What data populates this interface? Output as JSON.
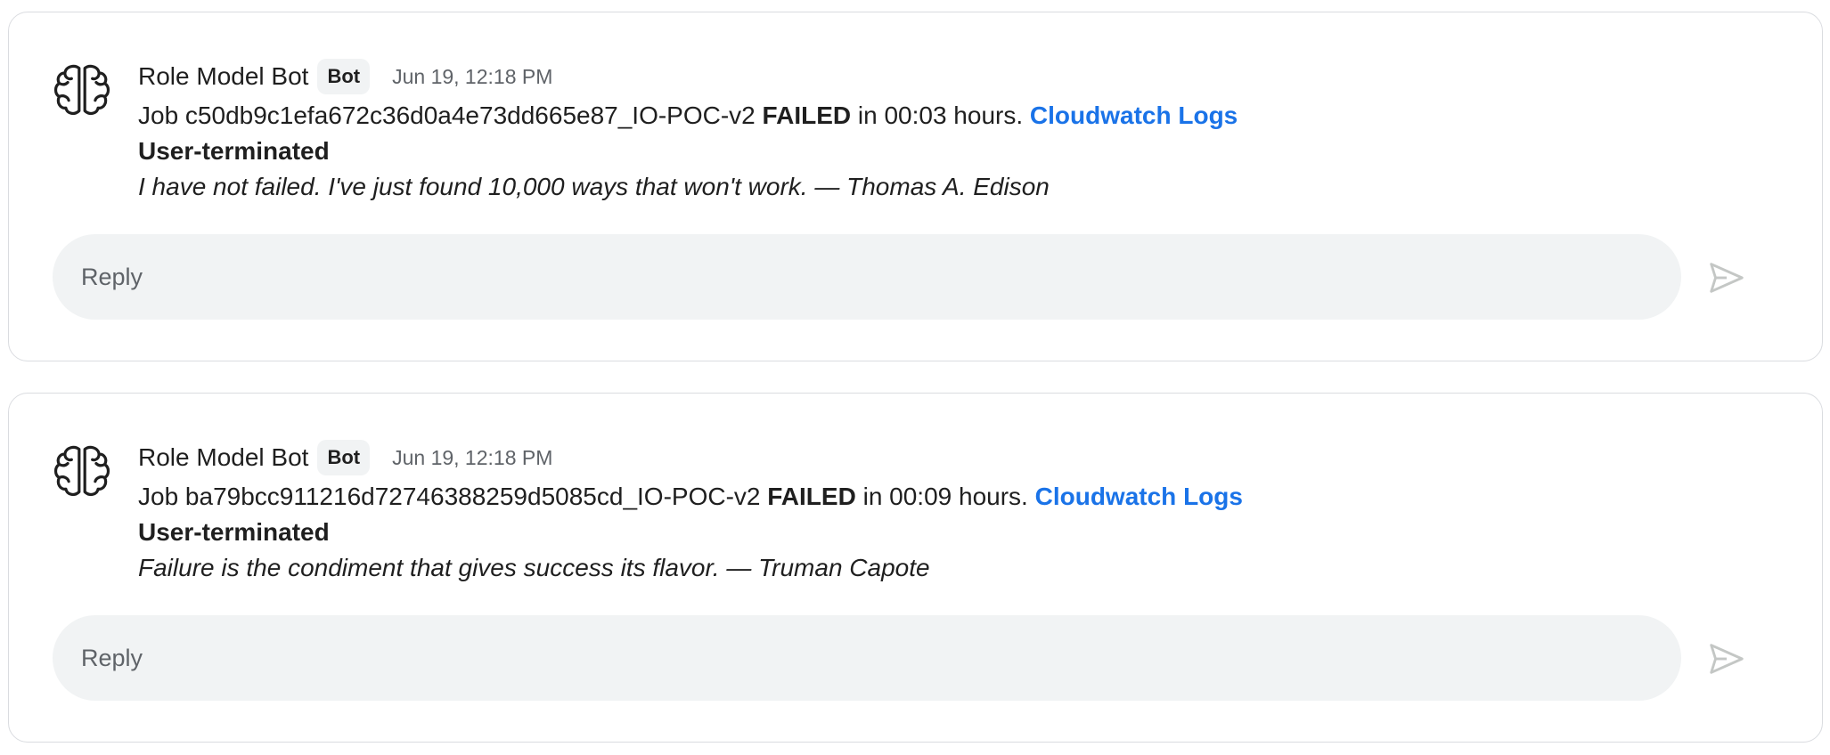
{
  "messages": [
    {
      "sender": "Role Model Bot",
      "badge": "Bot",
      "time": "Jun 19, 12:18 PM",
      "job_prefix": "Job c50db9c1efa672c36d0a4e73dd665e87_IO-POC-v2",
      "status": "FAILED",
      "duration_text": "in 00:03 hours.",
      "link_label": "Cloudwatch Logs",
      "reason": "User-terminated",
      "quote": "I have not failed. I've just found 10,000 ways that won't work. — Thomas A. Edison",
      "reply_placeholder": "Reply",
      "avatar_icon": "brain-icon",
      "send_icon": "send-icon"
    },
    {
      "sender": "Role Model Bot",
      "badge": "Bot",
      "time": "Jun 19, 12:18 PM",
      "job_prefix": "Job ba79bcc911216d72746388259d5085cd_IO-POC-v2",
      "status": "FAILED",
      "duration_text": "in 00:09 hours.",
      "link_label": "Cloudwatch Logs",
      "reason": "User-terminated",
      "quote": "Failure is the condiment that gives success its flavor. — Truman Capote",
      "reply_placeholder": "Reply",
      "avatar_icon": "brain-icon",
      "send_icon": "send-icon"
    }
  ],
  "colors": {
    "link": "#1a73e8",
    "reply_background": "#f1f3f4",
    "border": "#dadce0",
    "muted_text": "#5f6368"
  }
}
